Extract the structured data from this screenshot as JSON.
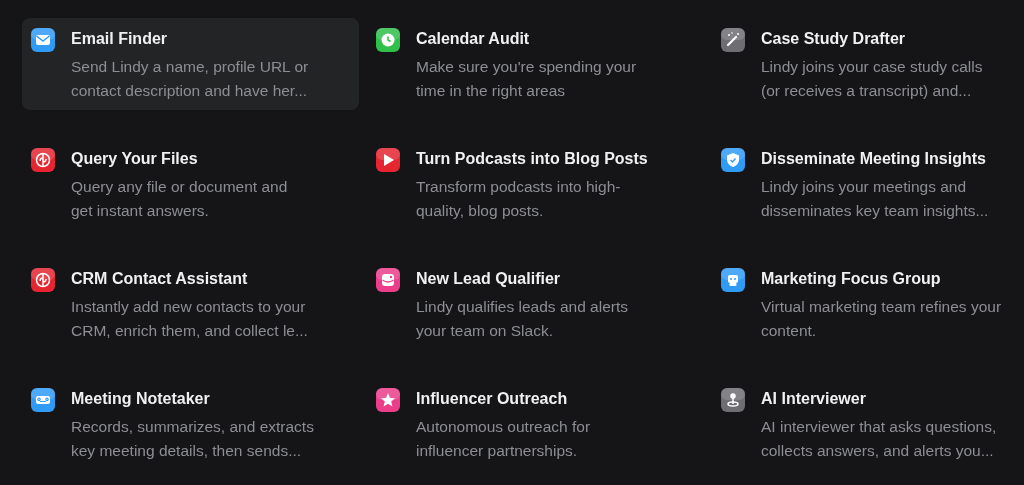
{
  "templates": [
    {
      "title": "Email Finder",
      "description": "Send Lindy a name, profile URL or\ncontact description and have her...",
      "kind": "envelope",
      "color": "#2f9bf5",
      "selected": true
    },
    {
      "title": "Calendar Audit",
      "description": "Make sure you're spending your\ntime in the right areas",
      "kind": "clock",
      "color": "#2fbf4a",
      "selected": false
    },
    {
      "title": "Case Study Drafter",
      "description": "Lindy joins your case study calls\n(or receives a transcript) and...",
      "kind": "wand",
      "color": "#6e6e72",
      "selected": false
    },
    {
      "title": "Query Your Files",
      "description": "Query any file or document and\nget instant answers.",
      "kind": "brain",
      "color": "#e5252f",
      "selected": false
    },
    {
      "title": "Turn Podcasts into Blog Posts",
      "description": "Transform podcasts into high-\nquality, blog posts.",
      "kind": "play",
      "color": "#e5252f",
      "selected": false
    },
    {
      "title": "Disseminate Meeting Insights",
      "description": "Lindy joins your meetings and\ndisseminates key team insights...",
      "kind": "shield",
      "color": "#2f9bf5",
      "selected": false
    },
    {
      "title": "CRM Contact Assistant",
      "description": "Instantly add new contacts to your\nCRM, enrich them, and collect le...",
      "kind": "brain",
      "color": "#e5252f",
      "selected": false
    },
    {
      "title": "New Lead Qualifier",
      "description": "Lindy qualifies leads and alerts\nyour team on Slack.",
      "kind": "image",
      "color": "#ec3d8a",
      "selected": false
    },
    {
      "title": "Marketing Focus Group",
      "description": "Virtual marketing team refines your\ncontent.",
      "kind": "robot",
      "color": "#2f9bf5",
      "selected": false
    },
    {
      "title": "Meeting Notetaker",
      "description": "Records, summarizes, and extracts\nkey meeting details, then sends...",
      "kind": "cassette",
      "color": "#2f9bf5",
      "selected": false
    },
    {
      "title": "Influencer Outreach",
      "description": "Autonomous outreach for\ninfluencer partnerships.",
      "kind": "star",
      "color": "#ec3d8a",
      "selected": false
    },
    {
      "title": "AI Interviewer",
      "description": "AI interviewer that asks questions,\ncollects answers, and alerts you...",
      "kind": "pin",
      "color": "#6e6e72",
      "selected": false
    }
  ]
}
